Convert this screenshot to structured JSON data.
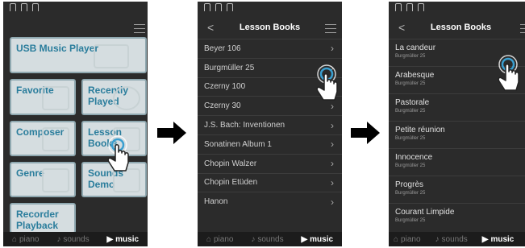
{
  "screen1": {
    "tiles": {
      "usb": "USB Music Player",
      "favorite": "Favorite",
      "recently": "Recently Played",
      "composer": "Composer",
      "lesson": "Lesson Books",
      "genre": "Genre",
      "sounds_demo": "Sounds Demo",
      "recorder": "Recorder Playback"
    }
  },
  "screen2": {
    "back": "<",
    "title": "Lesson Books",
    "items": [
      "Beyer 106",
      "Burgmüller 25",
      "Czerny 100",
      "Czerny 30",
      "J.S. Bach: Inventionen",
      "Sonatinen Album 1",
      "Chopin Walzer",
      "Chopin Etüden",
      "Hanon"
    ]
  },
  "screen3": {
    "back": "<",
    "title": "Lesson Books",
    "items": [
      {
        "title": "La candeur",
        "sub": "Burgmüller 25"
      },
      {
        "title": "Arabesque",
        "sub": "Burgmüller 25"
      },
      {
        "title": "Pastorale",
        "sub": "Burgmüller 25"
      },
      {
        "title": "Petite réunion",
        "sub": "Burgmüller 25"
      },
      {
        "title": "Innocence",
        "sub": "Burgmüller 25"
      },
      {
        "title": "Progrès",
        "sub": "Burgmüller 25"
      },
      {
        "title": "Courant Limpide",
        "sub": "Burgmüller 25"
      }
    ]
  },
  "nav": {
    "piano": "piano",
    "sounds": "sounds",
    "music": "music"
  },
  "colors": {
    "screen_bg": "#2b2b2b",
    "tile_text": "#2a7d9c",
    "tile_bg": "#d5dde0",
    "touch_ring": "#3a9fd0"
  },
  "icons": [
    "menu-icon",
    "chevron-right-icon",
    "back-icon",
    "piano-icon",
    "sounds-icon",
    "play-icon",
    "tap-hand-icon",
    "arrow-right-icon"
  ]
}
